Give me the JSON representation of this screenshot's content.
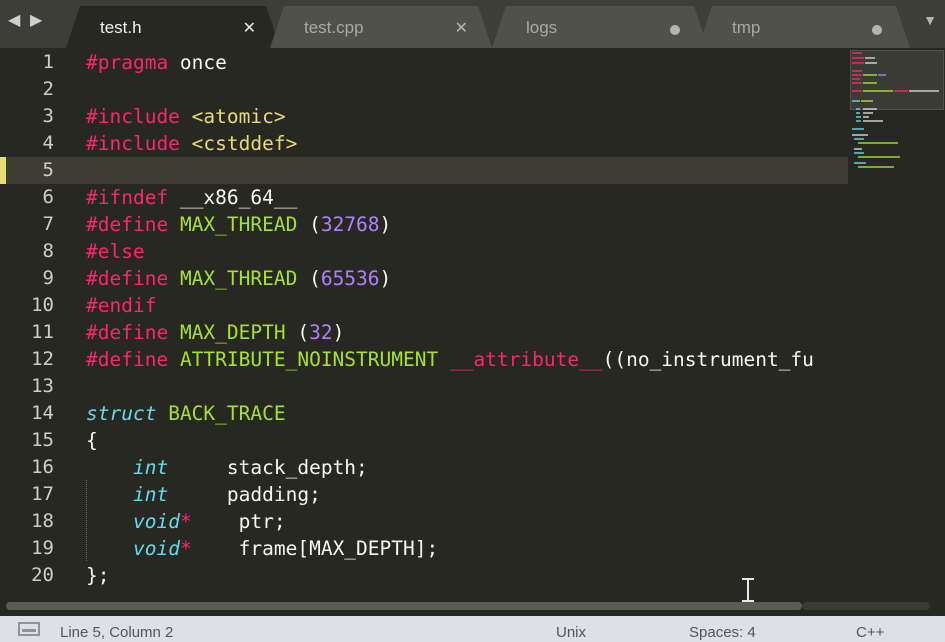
{
  "nav": {
    "back": "◀",
    "forward": "▶",
    "dropdown": "▼"
  },
  "tabs": [
    {
      "label": "test.h",
      "state": "active",
      "indicator": "✕"
    },
    {
      "label": "test.cpp",
      "state": "inactive",
      "indicator": "✕"
    },
    {
      "label": "logs",
      "state": "inactive-modified"
    },
    {
      "label": "tmp",
      "state": "inactive-modified"
    }
  ],
  "editor": {
    "line_numbers": [
      "1",
      "2",
      "3",
      "4",
      "5",
      "6",
      "7",
      "8",
      "9",
      "10",
      "11",
      "12",
      "13",
      "14",
      "15",
      "16",
      "17",
      "18",
      "19",
      "20"
    ],
    "current_line": 5,
    "lines": [
      {
        "parts": [
          {
            "t": "#pragma",
            "c": "k"
          },
          {
            "t": " once",
            "c": ""
          }
        ]
      },
      {
        "parts": []
      },
      {
        "parts": [
          {
            "t": "#include",
            "c": "k"
          },
          {
            "t": " ",
            "c": ""
          },
          {
            "t": "<atomic>",
            "c": "t2"
          }
        ]
      },
      {
        "parts": [
          {
            "t": "#include",
            "c": "k"
          },
          {
            "t": " ",
            "c": ""
          },
          {
            "t": "<cstddef>",
            "c": "t2"
          }
        ]
      },
      {
        "parts": []
      },
      {
        "parts": [
          {
            "t": "#ifndef",
            "c": "k"
          },
          {
            "t": " __x86_64__",
            "c": ""
          }
        ]
      },
      {
        "parts": [
          {
            "t": "#define",
            "c": "k"
          },
          {
            "t": " ",
            "c": ""
          },
          {
            "t": "MAX_THREAD",
            "c": "t"
          },
          {
            "t": " (",
            "c": ""
          },
          {
            "t": "32768",
            "c": "n"
          },
          {
            "t": ")",
            "c": ""
          }
        ]
      },
      {
        "parts": [
          {
            "t": "#else",
            "c": "k"
          }
        ]
      },
      {
        "parts": [
          {
            "t": "#define",
            "c": "k"
          },
          {
            "t": " ",
            "c": ""
          },
          {
            "t": "MAX_THREAD",
            "c": "t"
          },
          {
            "t": " (",
            "c": ""
          },
          {
            "t": "65536",
            "c": "n"
          },
          {
            "t": ")",
            "c": ""
          }
        ]
      },
      {
        "parts": [
          {
            "t": "#endif",
            "c": "k"
          }
        ]
      },
      {
        "parts": [
          {
            "t": "#define",
            "c": "k"
          },
          {
            "t": " ",
            "c": ""
          },
          {
            "t": "MAX_DEPTH",
            "c": "t"
          },
          {
            "t": " (",
            "c": ""
          },
          {
            "t": "32",
            "c": "n"
          },
          {
            "t": ")",
            "c": ""
          }
        ]
      },
      {
        "parts": [
          {
            "t": "#define",
            "c": "k"
          },
          {
            "t": " ",
            "c": ""
          },
          {
            "t": "ATTRIBUTE_NOINSTRUMENT",
            "c": "t"
          },
          {
            "t": " ",
            "c": ""
          },
          {
            "t": "__attribute__",
            "c": "k"
          },
          {
            "t": "((no_instrument_fu",
            "c": ""
          }
        ]
      },
      {
        "parts": []
      },
      {
        "parts": [
          {
            "t": "struct",
            "c": "s"
          },
          {
            "t": " ",
            "c": ""
          },
          {
            "t": "BACK_TRACE",
            "c": "t"
          }
        ]
      },
      {
        "parts": [
          {
            "t": "{",
            "c": ""
          }
        ]
      },
      {
        "parts": [
          {
            "t": "    ",
            "c": ""
          },
          {
            "t": "int",
            "c": "s"
          },
          {
            "t": "     stack_depth;",
            "c": ""
          }
        ]
      },
      {
        "parts": [
          {
            "t": "    ",
            "c": ""
          },
          {
            "t": "int",
            "c": "s"
          },
          {
            "t": "     padding;",
            "c": ""
          }
        ]
      },
      {
        "parts": [
          {
            "t": "    ",
            "c": ""
          },
          {
            "t": "void",
            "c": "s"
          },
          {
            "t": "*",
            "c": "k"
          },
          {
            "t": "    ptr;",
            "c": ""
          }
        ]
      },
      {
        "parts": [
          {
            "t": "    ",
            "c": ""
          },
          {
            "t": "void",
            "c": "s"
          },
          {
            "t": "*",
            "c": "k"
          },
          {
            "t": "    frame[MAX_DEPTH];",
            "c": ""
          }
        ]
      },
      {
        "parts": [
          {
            "t": "};",
            "c": ""
          }
        ]
      }
    ]
  },
  "colors": {
    "bg": "#272822",
    "keyword": "#f92672",
    "type": "#a6e22e",
    "number": "#ae81ff",
    "storage": "#66d9ef",
    "string": "#e6db74"
  },
  "status": {
    "position": "Line 5, Column 2",
    "line_endings": "Unix",
    "indentation": "Spaces: 4",
    "syntax": "C++"
  },
  "icons": [
    "back-arrow-icon",
    "forward-arrow-icon",
    "tab-close-icon",
    "tab-modified-dot-icon",
    "tab-dropdown-icon",
    "panel-toggle-icon",
    "text-cursor-icon"
  ]
}
